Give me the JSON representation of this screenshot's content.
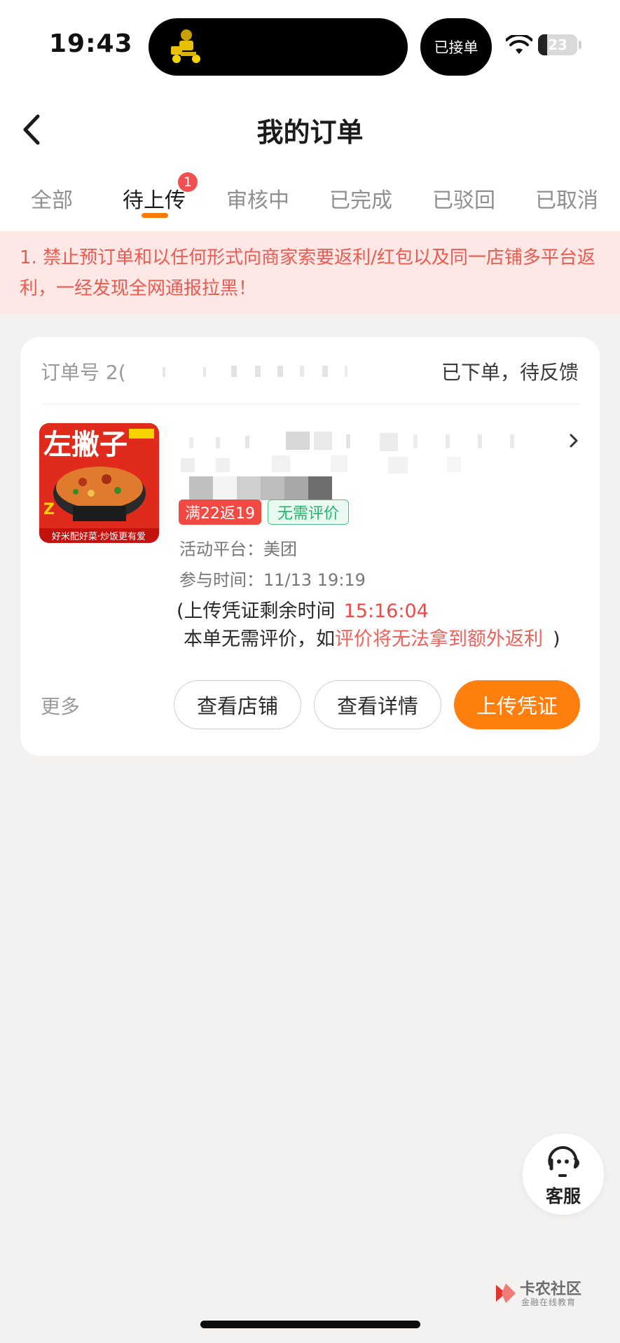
{
  "status_bar": {
    "time": "19:43",
    "live_activity_label": "已接单",
    "battery": "23",
    "battery_level_percent": 23
  },
  "header": {
    "title": "我的订单"
  },
  "tabs": [
    {
      "label": "全部"
    },
    {
      "label": "待上传",
      "badge": "1",
      "active": true
    },
    {
      "label": "审核中"
    },
    {
      "label": "已完成"
    },
    {
      "label": "已驳回"
    },
    {
      "label": "已取消"
    }
  ],
  "notice": {
    "text": "1. 禁止预订单和以任何形式向商家索要返利/红包以及同一店铺多平台返利，一经发现全网通报拉黑！"
  },
  "order": {
    "order_no_label": "订单号 2(",
    "status": "已下单，待反馈",
    "thumbnail_text": "左撇子",
    "thumbnail_caption": "好米配好菜·炒饭更有爱",
    "tag_rebate": "满22返19",
    "tag_review": "无需评价",
    "platform": "活动平台：美团",
    "join_time": "参与时间：11/13 19:19",
    "countdown_prefix": "(上传凭证剩余时间",
    "countdown": "15:16:04",
    "review_prefix": "本单无需评价，如",
    "review_warning": "评价将无法拿到额外返利",
    "review_suffix": ")",
    "more_label": "更多",
    "btn_shop": "查看店铺",
    "btn_detail": "查看详情",
    "btn_upload": "上传凭证"
  },
  "service": {
    "label": "客服"
  },
  "watermark": {
    "title": "卡农社区",
    "subtitle": "金融在线教育"
  },
  "colors": {
    "accent": "#ff7f0e",
    "notice_bg": "#fde8e6",
    "notice_text": "#ec5a50",
    "tag_red": "#f24a42",
    "tag_green": "#26b36b"
  }
}
